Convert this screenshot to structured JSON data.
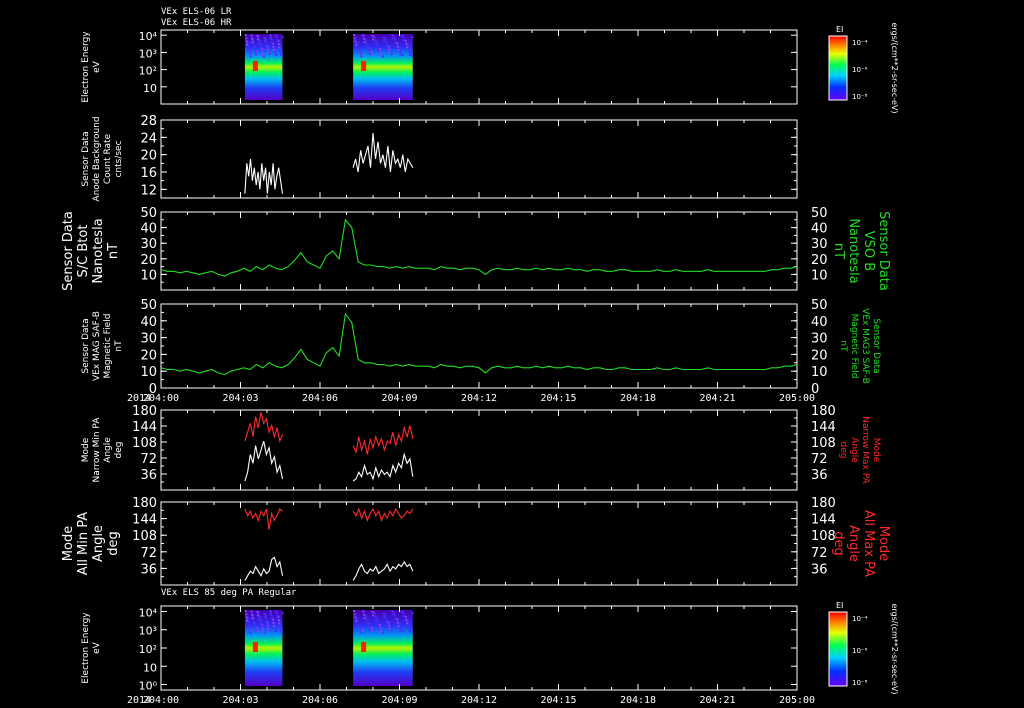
{
  "colors": {
    "background": "#000000",
    "axes": "#ffffff",
    "green": "#22dd22",
    "red": "#ff2a2a",
    "white": "#ffffff"
  },
  "chart_data": [
    {
      "type": "heatmap",
      "title_lines": [
        "VEx ELS-06 LR",
        "VEx ELS-06 HR"
      ],
      "ylabel_left": [
        "Electron Energy",
        "eV"
      ],
      "ytick_labels": [
        "10",
        "10²",
        "10³",
        "10⁴"
      ],
      "ytick_values": [
        10,
        100,
        1000,
        10000
      ],
      "yscale": "log",
      "ylim": [
        1,
        20000
      ],
      "colorbar": {
        "label": "EI",
        "tick_labels": [
          "10⁻⁴",
          "10⁻⁶",
          "10⁻⁸"
        ],
        "units": "ergs/(cm**2-sr-sec-eV)"
      },
      "segments": [
        [
          "204:03:10",
          "204:04:35"
        ],
        [
          "204:07:15",
          "204:09:30"
        ]
      ]
    },
    {
      "type": "line",
      "ylabel_left": [
        "Sensor Data",
        "Anode Background",
        "Count Rate",
        "cnts/sec"
      ],
      "ytick_labels": [
        "12",
        "16",
        "20",
        "24",
        "28"
      ],
      "ytick_values": [
        12,
        16,
        20,
        24,
        28
      ],
      "ylim": [
        10,
        28
      ],
      "series": [
        {
          "color": "white",
          "x_start": "204:03:10",
          "x_end": "204:04:35",
          "values": [
            11,
            18,
            15,
            19,
            14,
            17,
            13,
            16,
            12,
            18,
            14,
            17,
            11,
            16,
            13,
            18,
            12,
            15,
            17,
            14,
            11
          ]
        },
        {
          "color": "white",
          "x_start": "204:07:15",
          "x_end": "204:09:30",
          "values": [
            17,
            19,
            16,
            21,
            18,
            20,
            22,
            17,
            25,
            19,
            23,
            18,
            20,
            17,
            22,
            16,
            21,
            18,
            19,
            17,
            20,
            16,
            19,
            18,
            17
          ]
        }
      ]
    },
    {
      "type": "line",
      "ylabel_left": [
        "Sensor Data",
        "S/C Btot",
        "Nanotesla",
        "nT"
      ],
      "ylabel_right": [
        "Sensor Data",
        "VSO B",
        "Nanotesla",
        "nT"
      ],
      "ytick_labels": [
        "10",
        "20",
        "30",
        "40",
        "50"
      ],
      "ytick_values": [
        10,
        20,
        30,
        40,
        50
      ],
      "ylim": [
        0,
        50
      ],
      "series": [
        {
          "color": "green",
          "x_start": "204:00:00",
          "x_end": "205:00:00",
          "values": [
            13,
            12,
            12,
            11,
            12,
            11,
            10,
            11,
            12,
            10,
            9,
            11,
            12,
            14,
            12,
            15,
            13,
            16,
            14,
            13,
            15,
            19,
            24,
            18,
            16,
            14,
            22,
            25,
            20,
            45,
            40,
            18,
            16,
            16,
            15,
            15,
            14,
            15,
            14,
            15,
            14,
            14,
            14,
            13,
            15,
            14,
            14,
            13,
            14,
            14,
            13,
            10,
            13,
            14,
            13,
            13,
            14,
            13,
            13,
            14,
            13,
            14,
            13,
            13,
            14,
            13,
            13,
            12,
            13,
            13,
            12,
            12,
            13,
            13,
            12,
            12,
            12,
            12,
            13,
            12,
            12,
            13,
            12,
            12,
            12,
            12,
            13,
            12,
            12,
            12,
            12,
            12,
            12,
            12,
            12,
            12,
            13,
            13,
            14,
            14,
            15
          ]
        }
      ]
    },
    {
      "type": "line",
      "ylabel_left": [
        "Sensor Data",
        "VEx MAG SAF-B",
        "Magnetic Field",
        "nT"
      ],
      "ylabel_right": [
        "Sensor Data",
        "VEx MAG3 SAF-B",
        "Magnetic Field",
        "nT"
      ],
      "ytick_labels": [
        "0",
        "10",
        "20",
        "30",
        "40",
        "50"
      ],
      "ytick_values": [
        0,
        10,
        20,
        30,
        40,
        50
      ],
      "ylim": [
        0,
        50
      ],
      "xtick_labels": [
        "2014",
        "204:00",
        "204:03",
        "204:06",
        "204:09",
        "204:12",
        "204:15",
        "204:18",
        "204:21",
        "205:00"
      ],
      "series": [
        {
          "color": "green",
          "x_start": "204:00:00",
          "x_end": "205:00:00",
          "values": [
            12,
            11,
            11,
            10,
            11,
            10,
            9,
            10,
            11,
            9,
            8,
            10,
            11,
            12,
            11,
            14,
            12,
            15,
            13,
            12,
            14,
            18,
            23,
            17,
            15,
            13,
            21,
            24,
            19,
            44,
            39,
            17,
            15,
            15,
            14,
            14,
            13,
            14,
            13,
            14,
            13,
            13,
            13,
            12,
            14,
            13,
            13,
            12,
            13,
            13,
            12,
            9,
            12,
            13,
            12,
            12,
            13,
            12,
            12,
            13,
            12,
            13,
            12,
            12,
            13,
            12,
            12,
            11,
            12,
            12,
            11,
            11,
            12,
            12,
            11,
            11,
            11,
            11,
            12,
            11,
            11,
            12,
            11,
            11,
            11,
            11,
            12,
            11,
            11,
            11,
            11,
            11,
            11,
            11,
            11,
            11,
            12,
            12,
            13,
            13,
            14
          ]
        }
      ]
    },
    {
      "type": "line",
      "ylabel_left": [
        "Mode",
        "Narrow Min PA",
        "Angle",
        "deg"
      ],
      "ylabel_right": [
        "Mode",
        "Narrow Max PA",
        "Angle",
        "deg"
      ],
      "ytick_labels": [
        "36",
        "72",
        "108",
        "144",
        "180"
      ],
      "ytick_values": [
        36,
        72,
        108,
        144,
        180
      ],
      "ylim": [
        0,
        180
      ],
      "series": [
        {
          "color": "red",
          "x_start": "204:03:10",
          "x_end": "204:04:35",
          "values": [
            110,
            130,
            150,
            120,
            165,
            140,
            175,
            150,
            160,
            130,
            145,
            120,
            140,
            110,
            125
          ]
        },
        {
          "color": "white",
          "x_start": "204:03:10",
          "x_end": "204:04:35",
          "values": [
            20,
            40,
            80,
            60,
            100,
            70,
            90,
            110,
            80,
            95,
            60,
            75,
            40,
            55,
            25
          ]
        },
        {
          "color": "red",
          "x_start": "204:07:15",
          "x_end": "204:09:30",
          "values": [
            100,
            85,
            120,
            90,
            110,
            80,
            115,
            95,
            120,
            100,
            115,
            90,
            110,
            105,
            130,
            100,
            125,
            110,
            140,
            120,
            145,
            115
          ]
        },
        {
          "color": "white",
          "x_start": "204:07:15",
          "x_end": "204:09:30",
          "values": [
            20,
            25,
            40,
            30,
            55,
            35,
            40,
            25,
            50,
            30,
            45,
            35,
            40,
            30,
            55,
            40,
            60,
            50,
            80,
            60,
            70,
            30
          ]
        }
      ]
    },
    {
      "type": "line",
      "ylabel_left": [
        "Mode",
        "All Min PA",
        "Angle",
        "deg"
      ],
      "ylabel_right": [
        "Mode",
        "All Max PA",
        "Angle",
        "deg"
      ],
      "ytick_labels": [
        "36",
        "72",
        "108",
        "144",
        "180"
      ],
      "ytick_values": [
        36,
        72,
        108,
        144,
        180
      ],
      "ylim": [
        0,
        180
      ],
      "series": [
        {
          "color": "red",
          "x_start": "204:03:10",
          "x_end": "204:04:35",
          "values": [
            165,
            150,
            160,
            145,
            155,
            140,
            160,
            150,
            165,
            120,
            155,
            140,
            150,
            165,
            160
          ]
        },
        {
          "color": "white",
          "x_start": "204:03:10",
          "x_end": "204:04:35",
          "values": [
            10,
            20,
            30,
            25,
            40,
            30,
            20,
            35,
            25,
            30,
            55,
            60,
            40,
            50,
            20
          ]
        },
        {
          "color": "red",
          "x_start": "204:07:15",
          "x_end": "204:09:30",
          "values": [
            160,
            150,
            165,
            145,
            160,
            140,
            155,
            165,
            150,
            160,
            140,
            155,
            145,
            160,
            150,
            165,
            155,
            145,
            150,
            160,
            155,
            165
          ]
        },
        {
          "color": "white",
          "x_start": "204:07:15",
          "x_end": "204:09:30",
          "values": [
            10,
            20,
            35,
            45,
            30,
            25,
            35,
            30,
            40,
            25,
            30,
            35,
            45,
            30,
            40,
            35,
            45,
            40,
            50,
            40,
            45,
            30
          ]
        }
      ]
    },
    {
      "type": "heatmap",
      "title_lines": [
        "VEx ELS 85 deg PA Regular"
      ],
      "ylabel_left": [
        "Electron Energy",
        "eV"
      ],
      "ytick_labels": [
        "10⁰",
        "10",
        "10²",
        "10³",
        "10⁴"
      ],
      "ytick_values": [
        1,
        10,
        100,
        1000,
        10000
      ],
      "yscale": "log",
      "ylim": [
        0.5,
        20000
      ],
      "xtick_labels": [
        "2014",
        "204:00",
        "204:03",
        "204:06",
        "204:09",
        "204:12",
        "204:15",
        "204:18",
        "204:21",
        "205:00"
      ],
      "colorbar": {
        "label": "EI",
        "tick_labels": [
          "10⁻⁴",
          "10⁻⁶",
          "10⁻⁸"
        ],
        "units": "ergs/(cm**2-sr-sec-eV)"
      },
      "segments": [
        [
          "204:03:10",
          "204:04:35"
        ],
        [
          "204:07:15",
          "204:09:30"
        ]
      ]
    }
  ]
}
